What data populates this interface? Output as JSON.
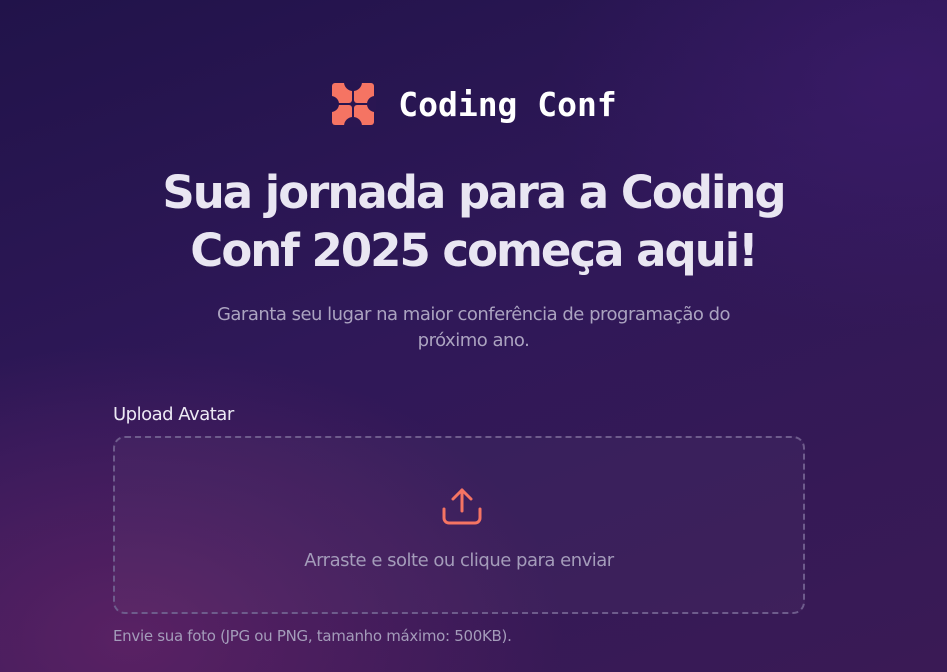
{
  "brand": {
    "name": "Coding Conf",
    "logo_icon": "coding-conf-logo-icon",
    "accent_color": "#f57463"
  },
  "hero": {
    "headline_line1": "Sua jornada para a Coding",
    "headline_line2": "Conf 2025 começa aqui!",
    "subtitle_line1": "Garanta seu lugar na maior conferência de programação do",
    "subtitle_line2": "próximo ano."
  },
  "upload": {
    "label": "Upload Avatar",
    "icon": "upload-icon",
    "dropzone_text": "Arraste e solte ou clique para enviar",
    "hint": "Envie sua foto (JPG ou PNG, tamanho máximo: 500KB)."
  }
}
